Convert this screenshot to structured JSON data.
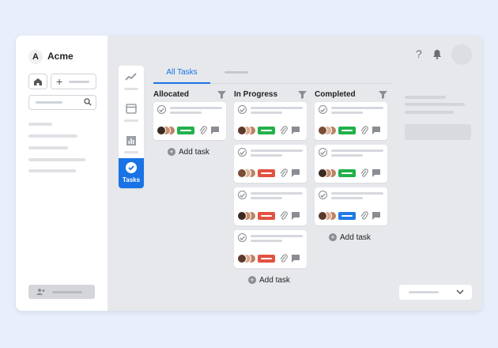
{
  "app": {
    "name": "Acme",
    "logo_letter": "A"
  },
  "rail": {
    "active_label": "Tasks"
  },
  "tabs": {
    "active": "All Tasks"
  },
  "columns": [
    {
      "title": "Allocated",
      "cards": [
        {
          "status": "green"
        }
      ],
      "add_label": "Add task"
    },
    {
      "title": "In Progress",
      "cards": [
        {
          "status": "green"
        },
        {
          "status": "red"
        },
        {
          "status": "red"
        },
        {
          "status": "red"
        }
      ],
      "add_label": "Add task"
    },
    {
      "title": "Completed",
      "cards": [
        {
          "status": "green"
        },
        {
          "status": "green"
        },
        {
          "status": "blue"
        }
      ],
      "add_label": "Add task"
    }
  ],
  "colors": {
    "accent": "#1973e6",
    "green": "#22b14c",
    "red": "#e25241",
    "blue": "#1f7ae6"
  },
  "icons": [
    "home-icon",
    "plus-icon",
    "search-icon",
    "trend-icon",
    "calendar-icon",
    "chart-icon",
    "check-icon",
    "filter-icon",
    "paperclip-icon",
    "comment-icon",
    "help-icon",
    "bell-icon",
    "user-icon",
    "chevron-down-icon"
  ],
  "header": {
    "help_glyph": "?"
  }
}
